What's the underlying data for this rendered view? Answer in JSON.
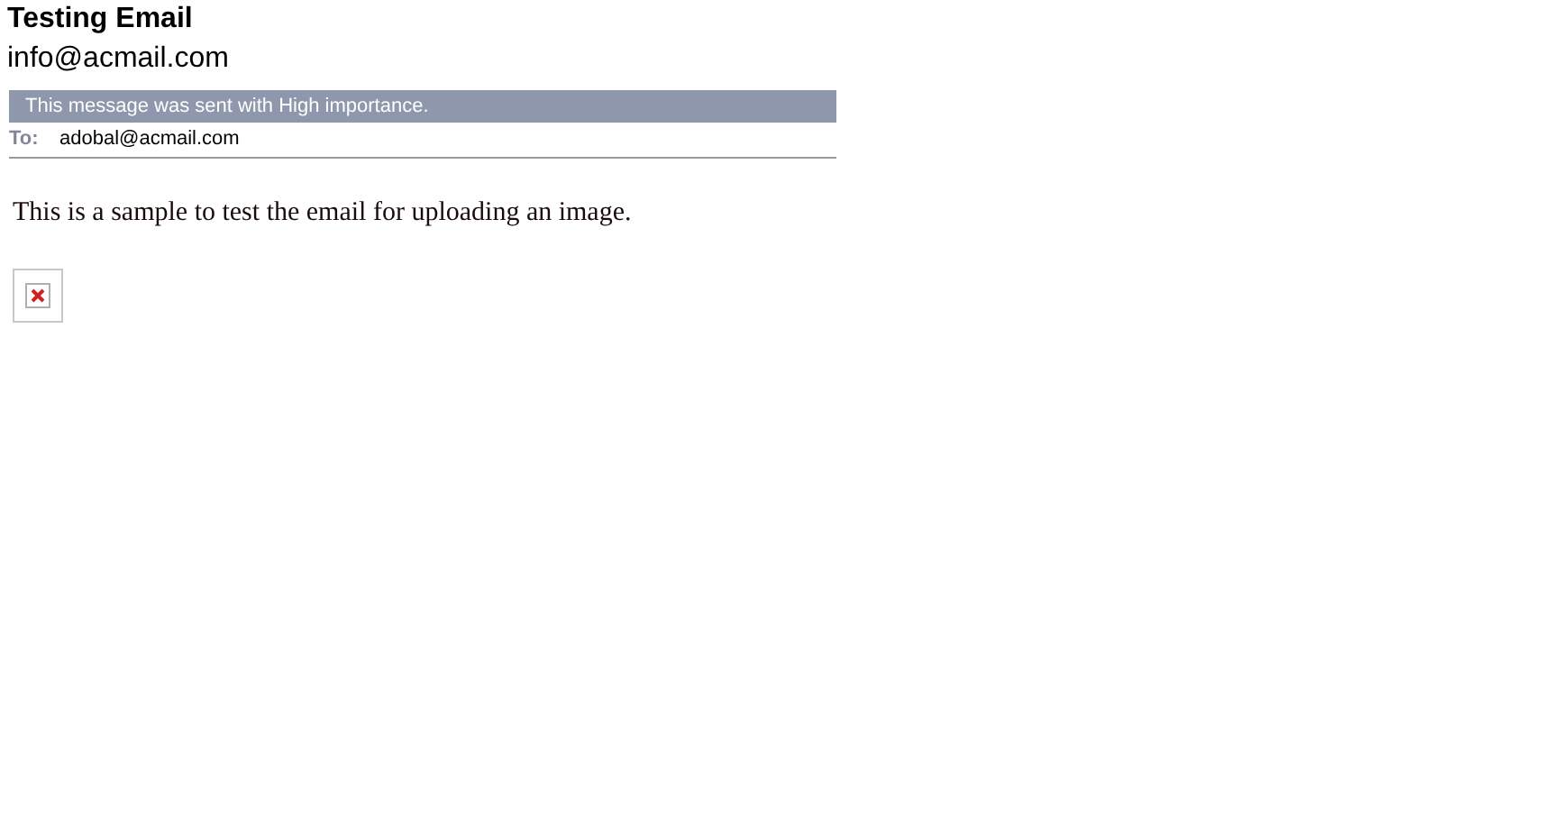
{
  "subject": "Testing Email",
  "sender": "info@acmail.com",
  "importance_banner": "This message was sent with High importance.",
  "to": {
    "label": "To:",
    "value": "adobal@acmail.com"
  },
  "body": "This is a sample to test the email for uploading an image.",
  "attachment": {
    "kind": "broken-image"
  }
}
